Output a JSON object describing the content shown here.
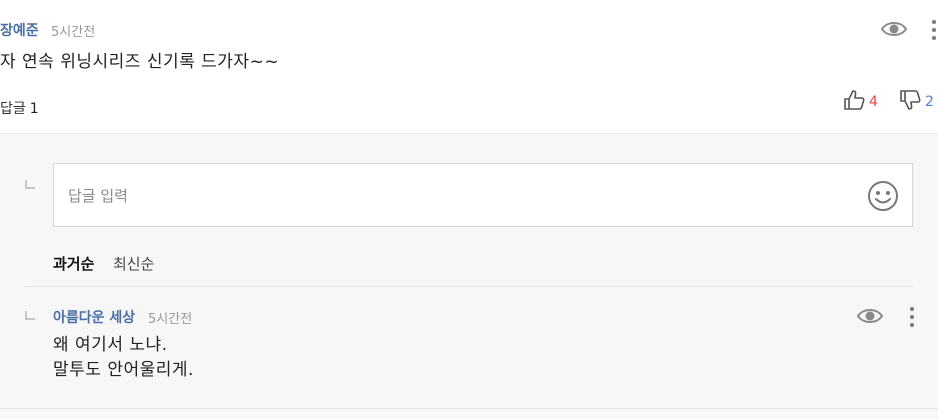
{
  "comment": {
    "author": "장예준",
    "time": "5시간전",
    "text": "자 연속 위닝시리즈 신기록 드가자~~",
    "replies_label": "답글",
    "replies_count": "1",
    "likes": "4",
    "dislikes": "2",
    "icons": {
      "eye": "eye-icon",
      "more": "more-vertical-icon",
      "like": "thumbs-up-icon",
      "dislike": "thumbs-down-icon"
    }
  },
  "reply_box": {
    "placeholder": "답글 입력",
    "emoji_icon": "smiley-icon"
  },
  "sort": {
    "oldest": "과거순",
    "newest": "최신순",
    "selected": "과거순"
  },
  "reply": {
    "author": "아름다운 세상",
    "time": "5시간전",
    "lines": [
      "왜 여기서 노냐.",
      "말투도 안어울리게."
    ]
  },
  "colors": {
    "author": "#4a6fa5",
    "like": "#e04848",
    "dislike": "#4a7fd9",
    "panel_bg": "#f7f7f7"
  }
}
